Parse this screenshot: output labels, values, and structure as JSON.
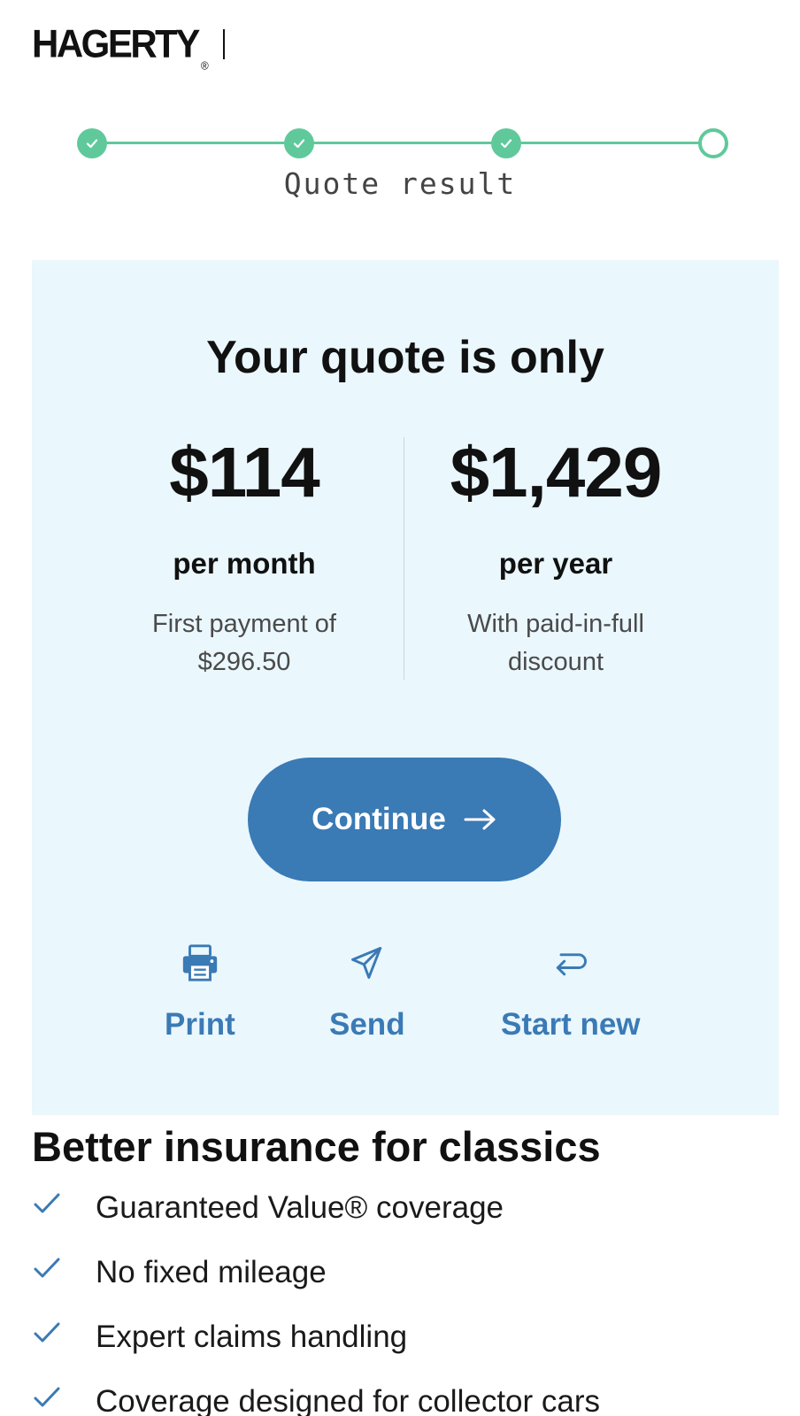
{
  "header": {
    "logo_text": "HAGERTY",
    "logo_mark": "®"
  },
  "progress": {
    "steps": [
      {
        "state": "done",
        "icon": "check-icon"
      },
      {
        "state": "done",
        "icon": "check-icon"
      },
      {
        "state": "done",
        "icon": "check-icon"
      },
      {
        "state": "current"
      }
    ],
    "current_label": "Quote result"
  },
  "quote": {
    "title": "Your quote is only",
    "monthly": {
      "price": "$114",
      "period": "per month",
      "note": "First payment of $296.50"
    },
    "yearly": {
      "price": "$1,429",
      "period": "per year",
      "note": "With paid-in-full discount"
    },
    "continue_label": "Continue",
    "actions": [
      {
        "label": "Print",
        "icon": "printer-icon"
      },
      {
        "label": "Send",
        "icon": "paper-plane-icon"
      },
      {
        "label": "Start new",
        "icon": "return-arrow-icon"
      }
    ]
  },
  "benefits": {
    "title": "Better insurance for classics",
    "items": [
      "Guaranteed Value® coverage",
      "No fixed mileage",
      "Expert claims handling",
      "Coverage designed for collector cars"
    ]
  },
  "colors": {
    "accent_blue": "#3a7ab5",
    "progress_green": "#60c99c",
    "card_background": "#eaf7fd"
  }
}
